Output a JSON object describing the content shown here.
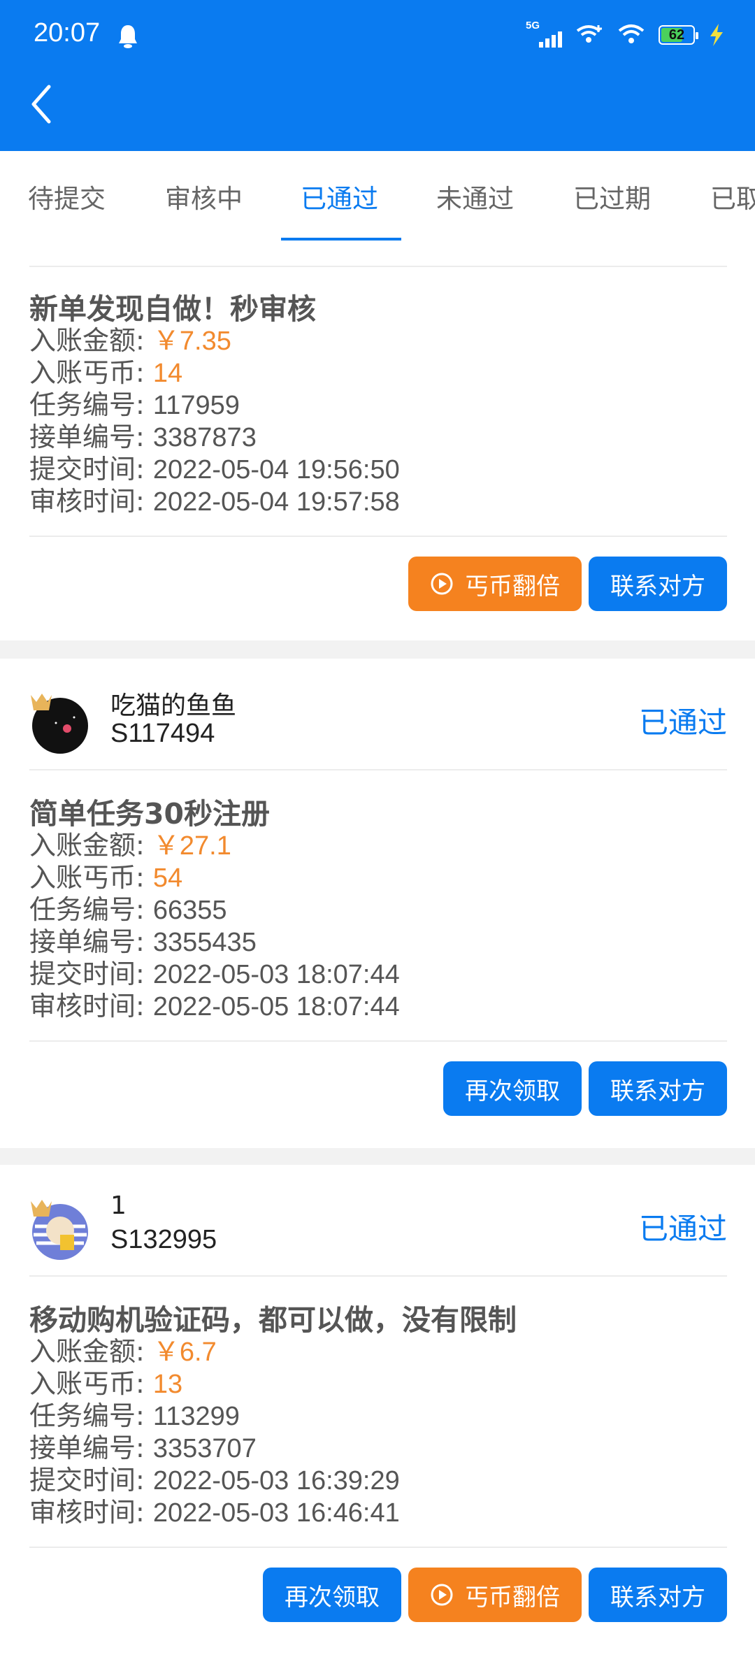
{
  "status_bar": {
    "time": "20:07",
    "network": "5G",
    "battery": "62"
  },
  "tabs": [
    {
      "label": "待提交"
    },
    {
      "label": "审核中"
    },
    {
      "label": "已通过",
      "active": true
    },
    {
      "label": "未通过"
    },
    {
      "label": "已过期"
    },
    {
      "label": "已取"
    }
  ],
  "labels": {
    "amount": "入账金额: ",
    "coins": "入账丐币: ",
    "task_no": "任务编号: ",
    "order_no": "接单编号: ",
    "submit_time": "提交时间: ",
    "review_time": "审核时间: "
  },
  "buttons": {
    "double": "丐币翻倍",
    "contact": "联系对方",
    "again": "再次领取"
  },
  "cards": [
    {
      "title": "新单发现自做！秒审核",
      "amount": "￥7.35",
      "coins": "14",
      "task_no": "117959",
      "order_no": "3387873",
      "submit_time": "2022-05-04 19:56:50",
      "review_time": "2022-05-04 19:57:58"
    },
    {
      "username": "吃猫的鱼鱼",
      "userid": "S117494",
      "status": "已通过",
      "title": "简单任务30秒注册",
      "amount": "￥27.1",
      "coins": "54",
      "task_no": "66355",
      "order_no": "3355435",
      "submit_time": "2022-05-03 18:07:44",
      "review_time": "2022-05-05 18:07:44"
    },
    {
      "username": "1",
      "userid": "S132995",
      "status": "已通过",
      "title": "移动购机验证码，都可以做，没有限制",
      "amount": "￥6.7",
      "coins": "13",
      "task_no": "113299",
      "order_no": "3353707",
      "submit_time": "2022-05-03 16:39:29",
      "review_time": "2022-05-03 16:46:41"
    }
  ],
  "colors": {
    "primary": "#0a7bf0",
    "accent_orange": "#f5821f",
    "value_orange": "#f28a2e"
  }
}
